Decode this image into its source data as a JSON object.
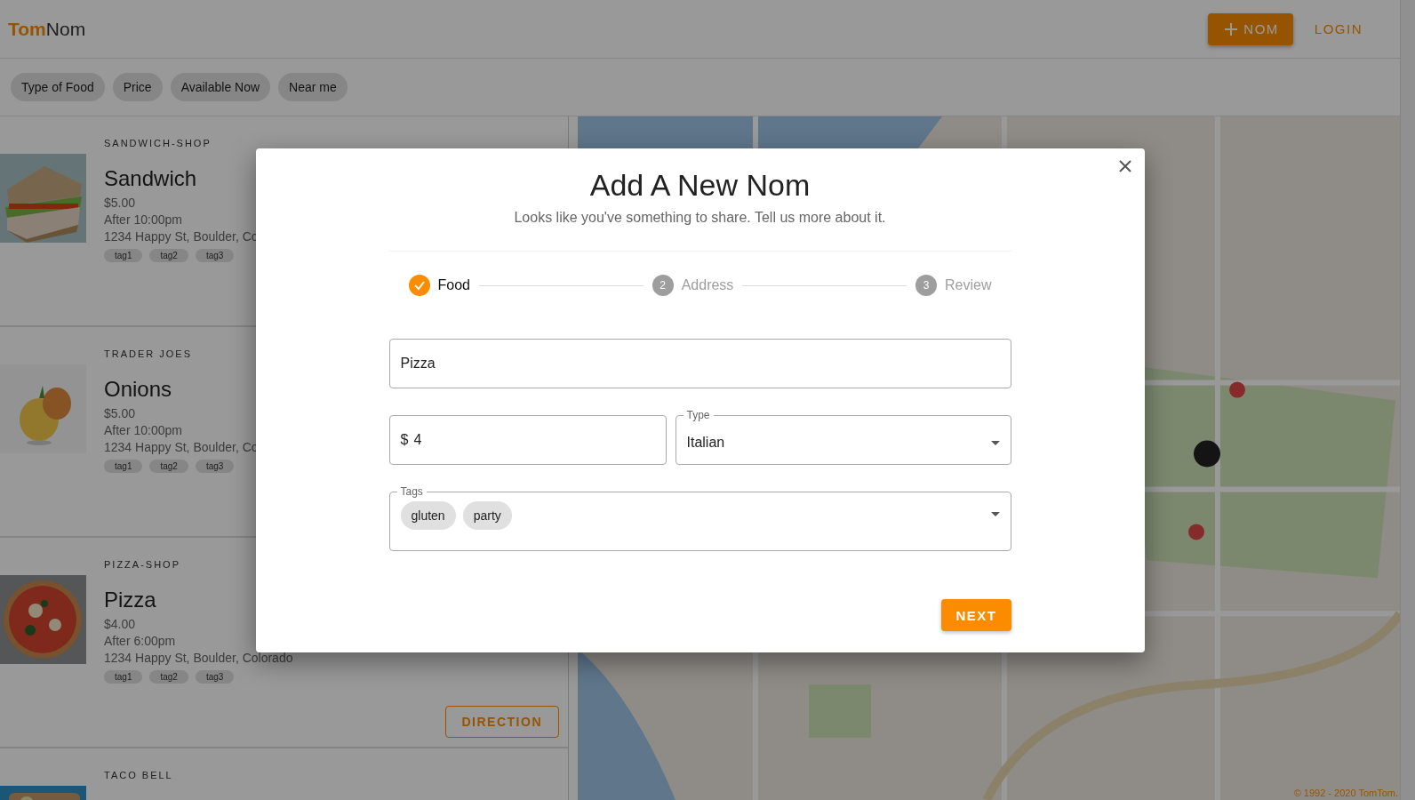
{
  "header": {
    "logo_bold": "Tom",
    "logo_rest": "Nom",
    "add_button": "NOM",
    "login": "LOGIN"
  },
  "filters": [
    {
      "label": "Type of Food"
    },
    {
      "label": "Price"
    },
    {
      "label": "Available Now"
    },
    {
      "label": "Near me"
    }
  ],
  "listings": [
    {
      "shop": "SANDWICH-SHOP",
      "name": "Sandwich",
      "price": "$5.00",
      "time": "After 10:00pm",
      "address": "1234 Happy St, Boulder, Co",
      "tags": [
        "tag1",
        "tag2",
        "tag3"
      ]
    },
    {
      "shop": "TRADER JOES",
      "name": "Onions",
      "price": "$5.00",
      "time": "After 10:00pm",
      "address": "1234 Happy St, Boulder, Co",
      "tags": [
        "tag1",
        "tag2",
        "tag3"
      ]
    },
    {
      "shop": "PIZZA-SHOP",
      "name": "Pizza",
      "price": "$4.00",
      "time": "After 6:00pm",
      "address": "1234 Happy St, Boulder, Colorado",
      "tags": [
        "tag1",
        "tag2",
        "tag3"
      ],
      "direction": "DIRECTION"
    },
    {
      "shop": "TACO BELL"
    }
  ],
  "map": {
    "kind": "picture",
    "attribution": "© 1992 - 2020 TomTom."
  },
  "modal": {
    "title": "Add A New Nom",
    "subtitle": "Looks like you've something to share. Tell us more about it.",
    "steps": [
      {
        "label": "Food",
        "completed": true
      },
      {
        "label": "Address",
        "completed": false,
        "number": "2"
      },
      {
        "label": "Review",
        "completed": false,
        "number": "3"
      }
    ],
    "name_field": {
      "value": "Pizza"
    },
    "price_field": {
      "adornment": "$",
      "value": "4"
    },
    "type_field": {
      "label": "Type",
      "value": "Italian"
    },
    "tags_field": {
      "label": "Tags",
      "chips": [
        "gluten",
        "party"
      ]
    },
    "next_button": "NEXT"
  }
}
